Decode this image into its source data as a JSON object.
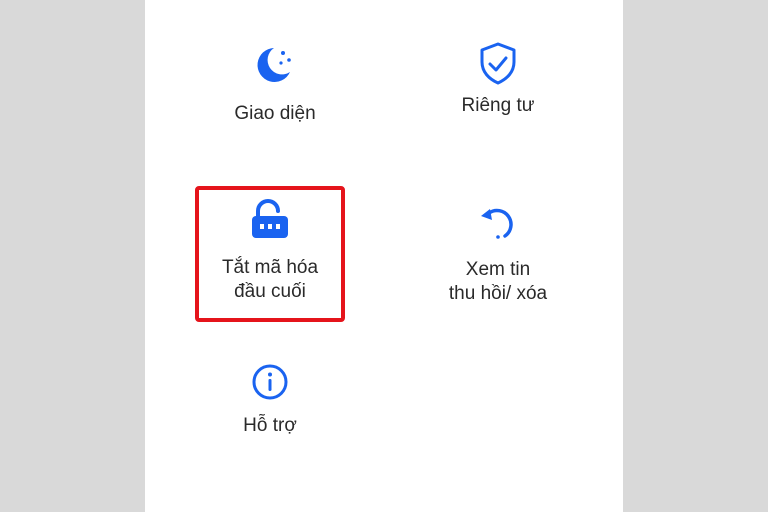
{
  "accent_color": "#1a63f0",
  "highlight_color": "#e5141b",
  "menu": {
    "appearance": {
      "label": "Giao diện",
      "icon": "moon-stars-icon"
    },
    "privacy": {
      "label": "Riêng tư",
      "icon": "shield-check-icon"
    },
    "e2ee_off": {
      "label_line1": "Tắt mã hóa",
      "label_line2": "đầu cuối",
      "icon": "lock-unlocked-icon",
      "highlighted": true
    },
    "recalled": {
      "label_line1": "Xem tin",
      "label_line2": "thu hồi/ xóa",
      "icon": "restore-icon"
    },
    "support": {
      "label": "Hỗ trợ",
      "icon": "info-icon"
    }
  }
}
